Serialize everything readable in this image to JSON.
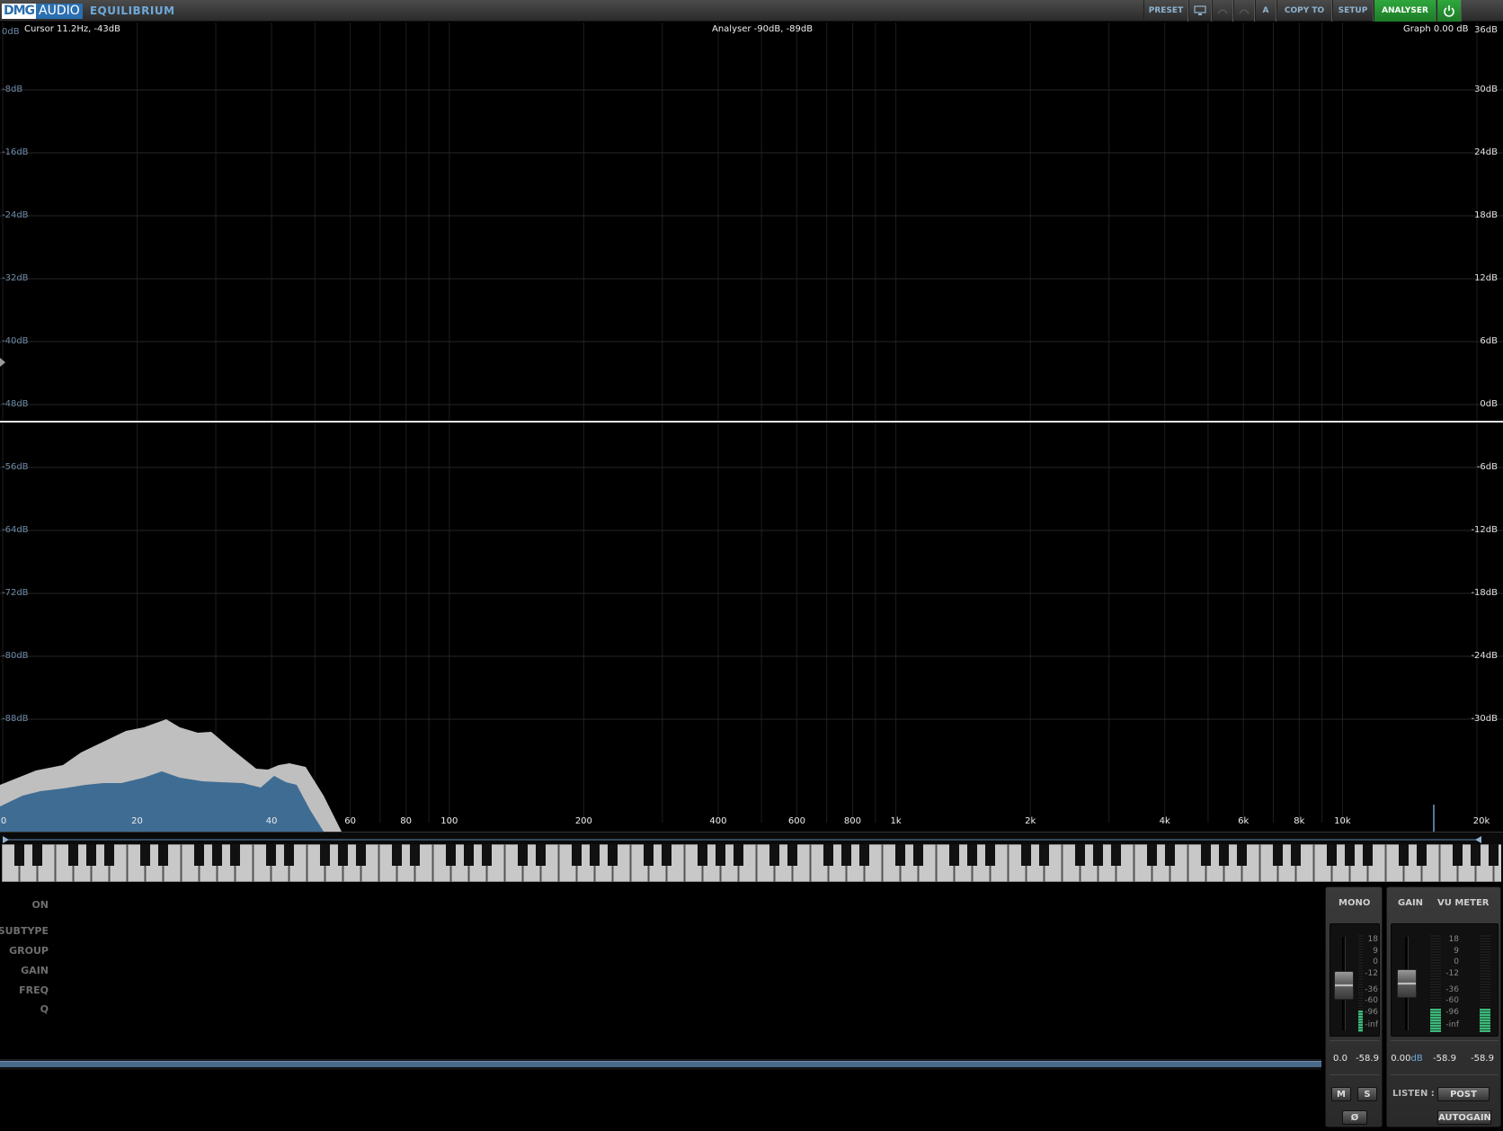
{
  "app": {
    "brand_dmg": "DMG",
    "brand_audio": "AUDIO",
    "product": "EQUILIBRIUM"
  },
  "toolbar": {
    "preset": "PRESET",
    "a_label": "A",
    "copy_to": "COPY TO",
    "setup": "SETUP",
    "analyser": "ANALYSER",
    "power_icon": "power-icon",
    "display_icon": "monitor-icon",
    "undo_icon": "undo-icon",
    "redo_icon": "redo-icon"
  },
  "graph": {
    "cursor_readout": "Cursor 11.2Hz, -43dB",
    "analyser_readout": "Analyser -90dB, -89dB",
    "graph_readout": "Graph 0.00 dB",
    "left_scale": [
      "0dB",
      "-8dB",
      "-16dB",
      "-24dB",
      "-32dB",
      "-40dB",
      "-48dB",
      "-56dB",
      "-64dB",
      "-72dB",
      "-80dB",
      "-88dB"
    ],
    "right_scale": [
      "36dB",
      "30dB",
      "24dB",
      "18dB",
      "12dB",
      "6dB",
      "0dB",
      "-6dB",
      "-12dB",
      "-18dB",
      "-24dB",
      "-30dB"
    ],
    "freq_labels": [
      "0",
      "20",
      "40",
      "60",
      "80",
      "100",
      "200",
      "400",
      "600",
      "800",
      "1k",
      "2k",
      "4k",
      "6k",
      "8k",
      "10k",
      "20k"
    ]
  },
  "properties": {
    "on": "ON",
    "subtype": "SUBTYPE",
    "group": "GROUP",
    "gain": "GAIN",
    "freq": "FREQ",
    "q": "Q"
  },
  "mono_panel": {
    "title": "MONO",
    "scale": [
      "18",
      "9",
      "0",
      "-12",
      "-36",
      "-60",
      "-96",
      "-inf"
    ],
    "fader_value": "0.0",
    "meter_value": "-58.9",
    "m_button": "M",
    "s_button": "S",
    "phase_button": "Ø",
    "meter_level": 0.22
  },
  "gain_panel": {
    "gain_title": "GAIN",
    "vu_title": "VU METER",
    "scale": [
      "18",
      "9",
      "0",
      "-12",
      "-36",
      "-60",
      "-96",
      "-inf"
    ],
    "gain_value": "0.00",
    "gain_unit": "dB",
    "meter_left": "-58.9",
    "meter_right": "-58.9",
    "listen_label": "LISTEN :",
    "post_button": "POST",
    "autogain_button": "AUTOGAIN",
    "meter_level": 0.24
  },
  "colors": {
    "analyser_post": "#3e6687",
    "analyser_pre": "#bdbdbd",
    "accent_green": "#24913a",
    "curve": "#dddddd"
  }
}
